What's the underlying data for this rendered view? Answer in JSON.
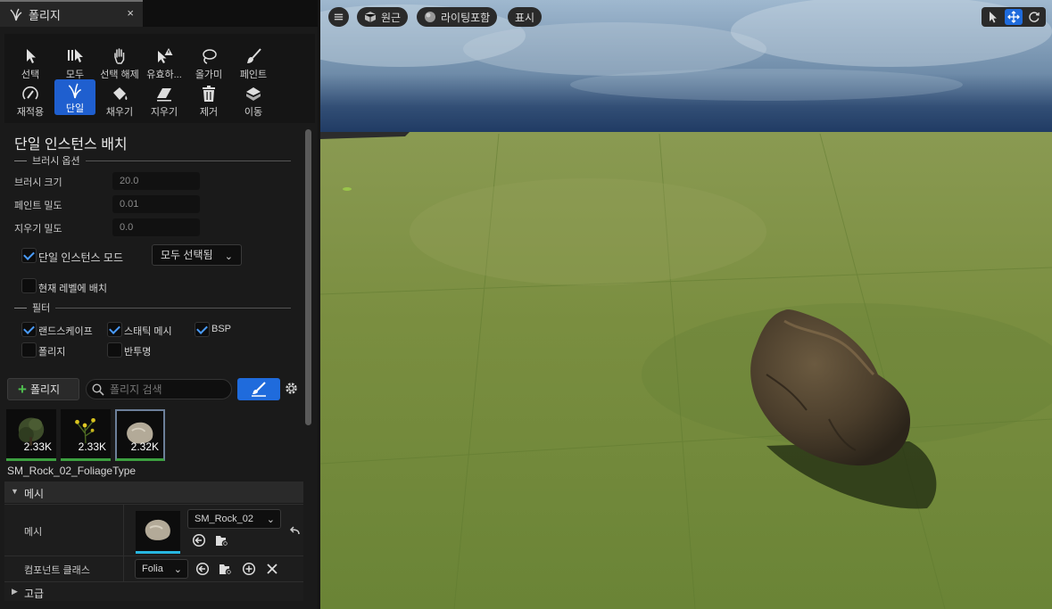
{
  "tab": {
    "title": "폴리지",
    "close": "×"
  },
  "tools": [
    {
      "label": "선택",
      "icon": "arrow-cursor-icon"
    },
    {
      "label": "모두",
      "icon": "select-all-icon"
    },
    {
      "label": "선택 해제",
      "icon": "deselect-hand-icon"
    },
    {
      "label": "유효하...",
      "icon": "invalid-warning-icon"
    },
    {
      "label": "올가미",
      "icon": "lasso-icon"
    },
    {
      "label": "페인트",
      "icon": "paint-brush-icon"
    },
    {
      "label": "재적용",
      "icon": "reapply-icon"
    },
    {
      "label": "단일",
      "icon": "single-grass-icon",
      "active": true
    },
    {
      "label": "채우기",
      "icon": "fill-bucket-icon"
    },
    {
      "label": "지우기",
      "icon": "eraser-icon"
    },
    {
      "label": "제거",
      "icon": "trash-icon"
    },
    {
      "label": "이동",
      "icon": "move-icon"
    }
  ],
  "section_title": "단일 인스턴스 배치",
  "brush_options": {
    "heading": "브러시 옵션",
    "brush_size_label": "브러시 크기",
    "brush_size_value": "20.0",
    "paint_density_label": "페인트 밀도",
    "paint_density_value": "0.01",
    "erase_density_label": "지우기 밀도",
    "erase_density_value": "0.0",
    "single_instance_mode_label": "단일 인스턴스 모드",
    "single_instance_mode_checked": true,
    "mode_dropdown": "모두 선택됨",
    "place_current_level_label": "현재 레벨에 배치",
    "place_current_level_checked": false
  },
  "filters": {
    "heading": "필터",
    "items": [
      {
        "label": "랜드스케이프",
        "checked": true
      },
      {
        "label": "스태틱 메시",
        "checked": true
      },
      {
        "label": "BSP",
        "checked": true
      },
      {
        "label": "폴리지",
        "checked": false
      },
      {
        "label": "반투명",
        "checked": false
      }
    ]
  },
  "foliage_toolbar": {
    "add_label": "폴리지",
    "search_placeholder": "폴리지 검색"
  },
  "foliage_types": [
    {
      "count": "2.33K",
      "icon": "tree-thumbnail-icon"
    },
    {
      "count": "2.33K",
      "icon": "yellow-flower-thumbnail-icon"
    },
    {
      "count": "2.32K",
      "icon": "rock-thumbnail-icon",
      "selected": true
    }
  ],
  "details": {
    "foliage_type_name": "SM_Rock_02_FoliageType",
    "mesh_category": "메시",
    "mesh_label": "메시",
    "mesh_asset": "SM_Rock_02",
    "component_class_label": "컴포넌트 클래스",
    "component_class_value": "Folia",
    "advanced_category": "고급"
  },
  "viewport": {
    "perspective_label": "원근",
    "lighting_label": "라이팅포함",
    "show_label": "표시"
  },
  "colors": {
    "accent": "#1f6bdc",
    "check": "#4a9cff",
    "thumb_bar": "#3ca040",
    "mesh_bar": "#27b6e0"
  }
}
